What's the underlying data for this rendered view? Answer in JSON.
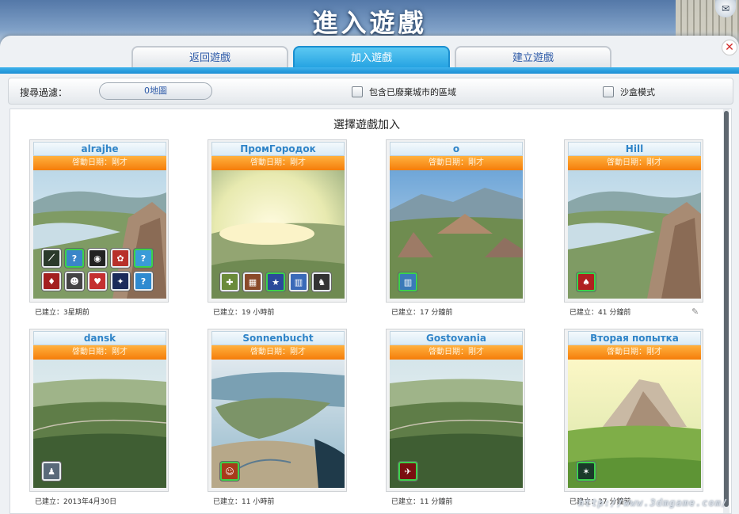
{
  "page_title": "進入遊戲",
  "tabs": [
    {
      "label": "返回遊戲",
      "active": false
    },
    {
      "label": "加入遊戲",
      "active": true
    },
    {
      "label": "建立遊戲",
      "active": false
    }
  ],
  "filter": {
    "label": "搜尋過濾：",
    "map_button": "0地圖",
    "include_abandoned": "包含已廢棄城市的區域",
    "sandbox": "沙盒模式"
  },
  "content_title": "選擇遊戲加入",
  "games": [
    {
      "name": "alrajhe",
      "start": "啓動日期：剛才",
      "created": "已建立：3星期前",
      "scene": "coast"
    },
    {
      "name": "ПромГородок",
      "start": "啓動日期：剛才",
      "created": "已建立：19 小時前",
      "scene": "haze"
    },
    {
      "name": "o",
      "start": "啓動日期：剛才",
      "created": "已建立：17 分鐘前",
      "scene": "valley"
    },
    {
      "name": "Hill",
      "start": "啓動日期：剛才",
      "created": "已建立：41 分鐘前",
      "scene": "coast"
    },
    {
      "name": "dansk",
      "start": "啓動日期：剛才",
      "created": "已建立：2013年4月30日",
      "scene": "forest"
    },
    {
      "name": "Sonnenbucht",
      "start": "啓動日期：剛才",
      "created": "已建立：11 小時前",
      "scene": "bay"
    },
    {
      "name": "Gostovania",
      "start": "啓動日期：剛才",
      "created": "已建立：11 分鐘前",
      "scene": "forest"
    },
    {
      "name": "Вторая попытка",
      "start": "啓動日期：剛才",
      "created": "已建立：37 分鐘前",
      "scene": "mountain"
    }
  ],
  "watermark": "http://www.3dmgame.com/",
  "colors": {
    "accent": "#1f9fe0",
    "orange": "#f57d0a",
    "name_text": "#2f84c8"
  }
}
